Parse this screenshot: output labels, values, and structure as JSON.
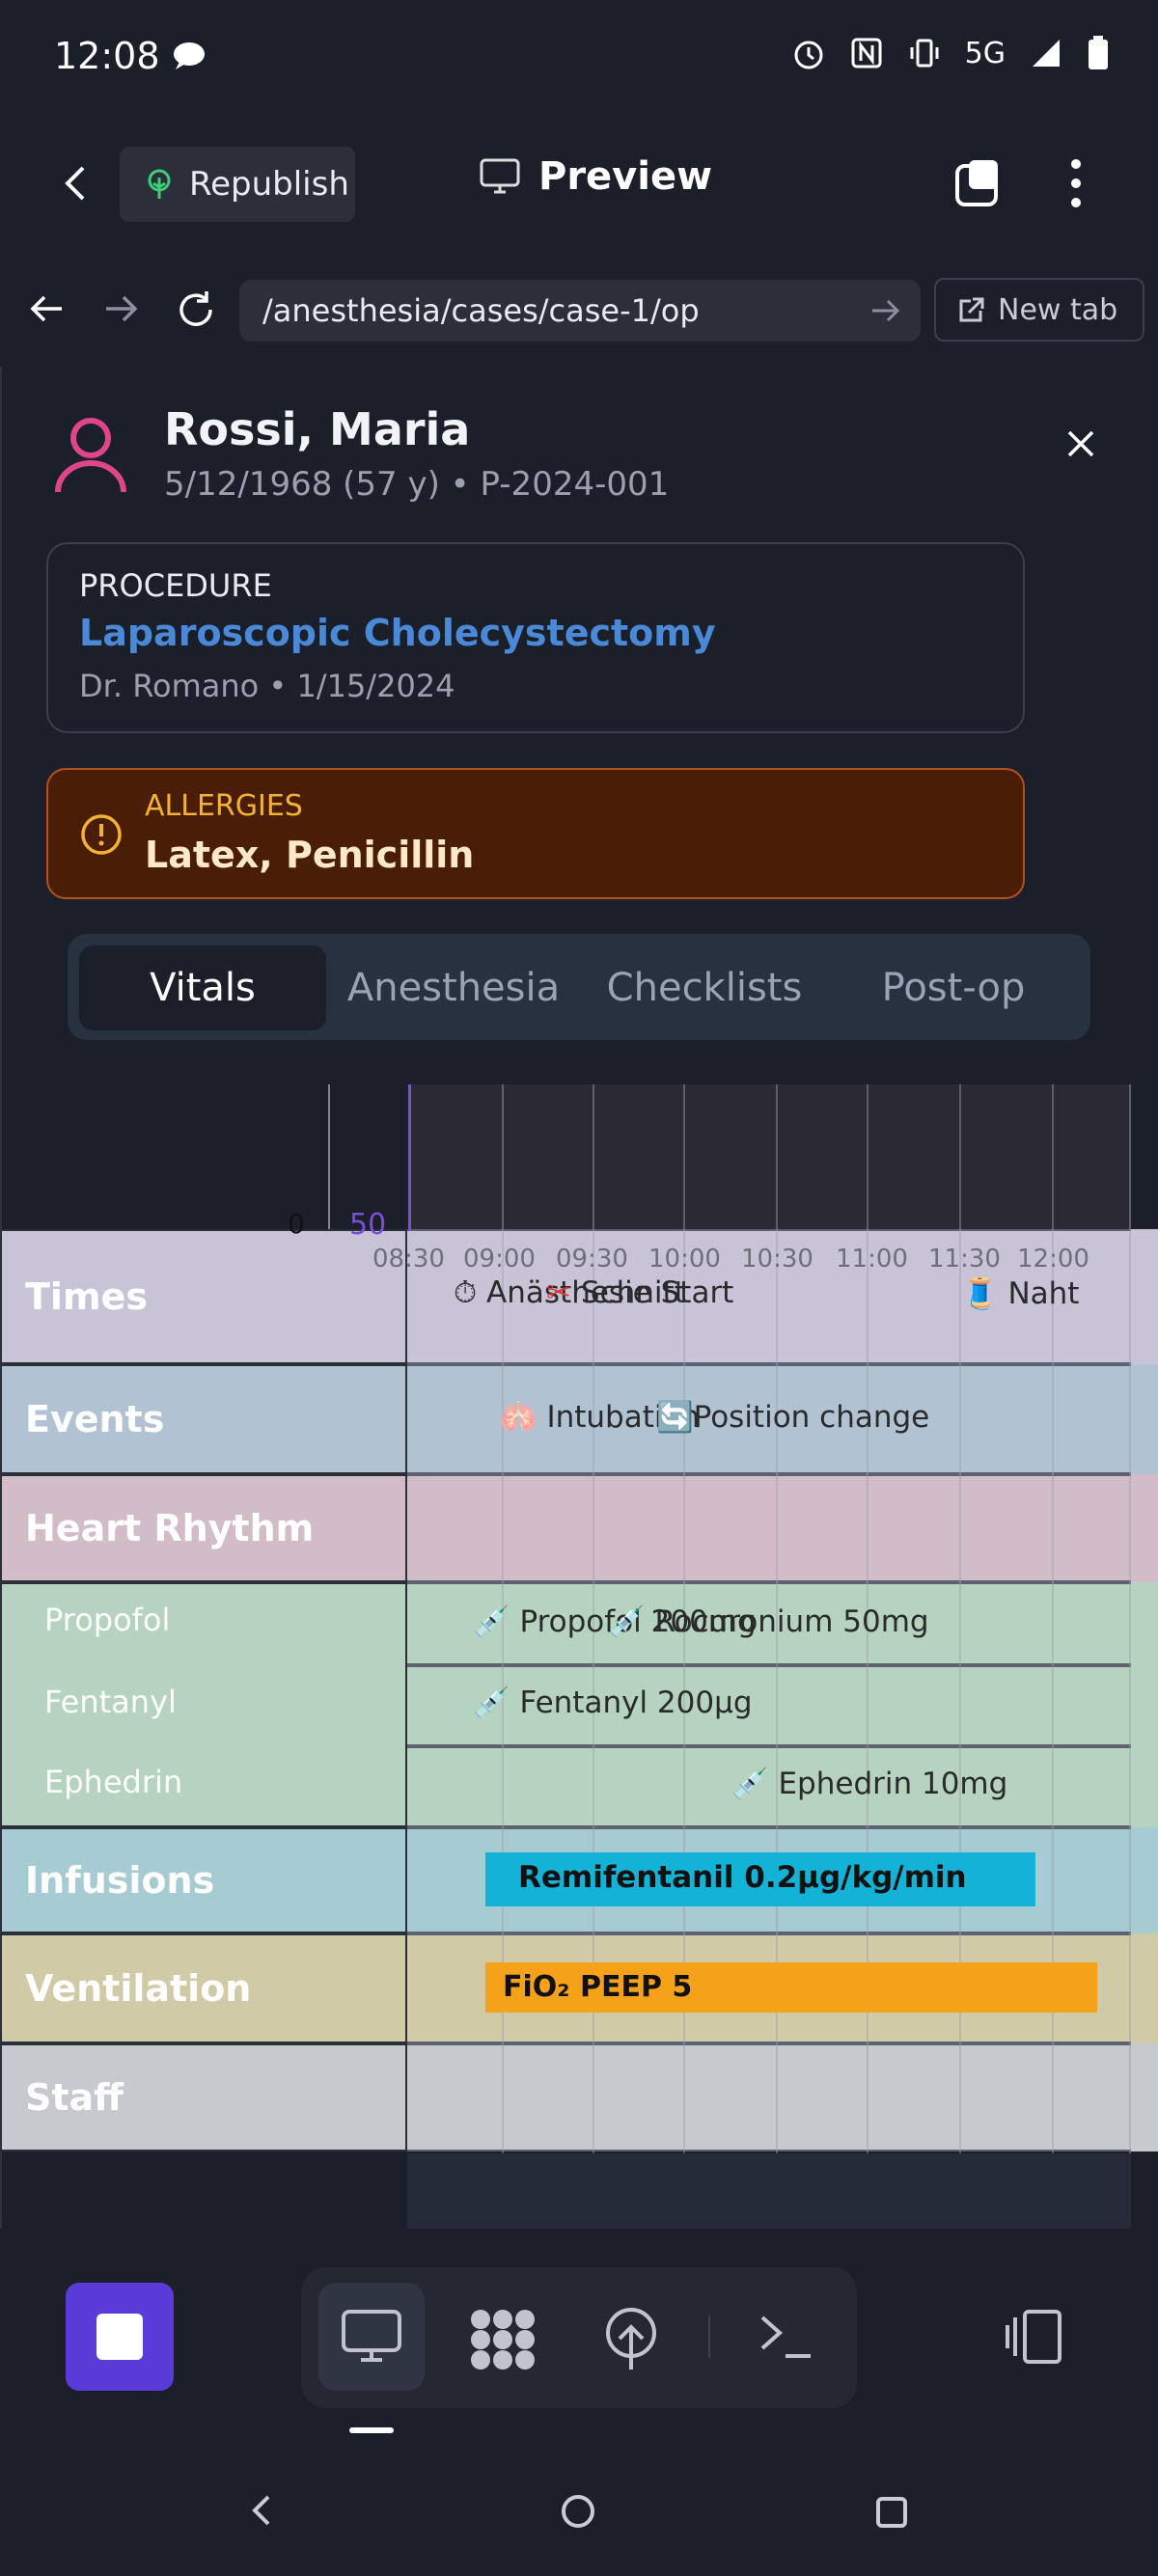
{
  "status": {
    "time": "12:08",
    "network": "5G"
  },
  "toolbar": {
    "republish": "Republish",
    "preview": "Preview"
  },
  "browser": {
    "url": "/anesthesia/cases/case-1/op",
    "new_tab": "New tab"
  },
  "patient": {
    "name": "Rossi, Maria",
    "meta": "5/12/1968 (57 y) • P-2024-001"
  },
  "procedure": {
    "label": "PROCEDURE",
    "name": "Laparoscopic Cholecystectomy",
    "meta": "Dr. Romano • 1/15/2024"
  },
  "allergies": {
    "label": "ALLERGIES",
    "value": "Latex, Penicillin"
  },
  "tabs": [
    "Vitals",
    "Anesthesia",
    "Checklists",
    "Post-op"
  ],
  "active_tab": "Vitals",
  "chart": {
    "axis_min": "0",
    "axis_max": "50",
    "times": [
      "08:30",
      "09:00",
      "09:30",
      "10:00",
      "10:30",
      "11:00",
      "11:30",
      "12:00"
    ]
  },
  "rows": {
    "times": "Times",
    "events": "Events",
    "heart_rhythm": "Heart Rhythm",
    "propofol": "Propofol",
    "fentanyl": "Fentanyl",
    "ephedrin": "Ephedrin",
    "infusions": "Infusions",
    "ventilation": "Ventilation",
    "staff": "Staff"
  },
  "timeline": {
    "anesthesia_start": "Anästhesie Start",
    "schnitt": "Schnitt",
    "naht": "Naht",
    "intubation": "Intubation",
    "position_change": "Position change",
    "propofol_dose": "Propofol 200mg",
    "rocuronium_dose": "Rocuronium 50mg",
    "fentanyl_dose": "Fentanyl 200µg",
    "ephedrin_dose": "Ephedrin 10mg",
    "remifentanil": "Remifentanil 0.2µg/kg/min",
    "fio2": "FiO₂",
    "peep": "PEEP 5"
  },
  "colors": {
    "accent": "#5a3bd8",
    "procedure_name": "#4a88d8",
    "allergy_bg": "#4a1d07",
    "times_band": "#c9c3d7",
    "events_band": "#b1c2d2",
    "heart_band": "#d2bcc8",
    "meds_band": "#b6d3c0",
    "infusions_band": "#a6cbd2",
    "ventilation_band": "#d0cba6",
    "staff_band": "#c6c9cd"
  }
}
